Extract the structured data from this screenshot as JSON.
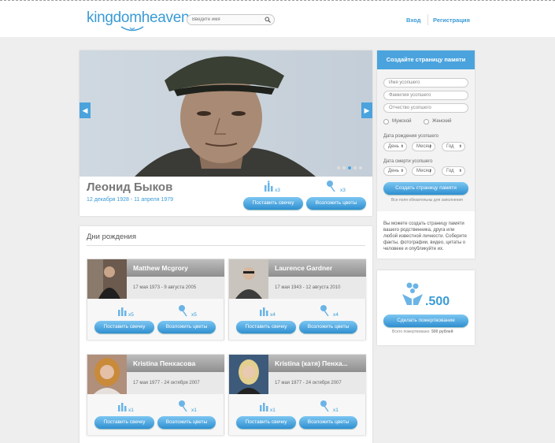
{
  "header": {
    "logo_text": "kingdomheaven",
    "search_placeholder": "Введите имя",
    "login_label": "Вход",
    "register_label": "Регистрация"
  },
  "hero": {
    "name": "Леонид Быков",
    "dates": "12 декабря 1928 - 11 апреля 1979",
    "candle_count": "x3",
    "flower_count": "x3",
    "candle_button": "Поставить свечку",
    "flower_button": "Возложить цветы"
  },
  "memorial_form": {
    "title": "Создайте страницу памяти",
    "first_name_placeholder": "Имя усопшего",
    "last_name_placeholder": "Фамилия усопшего",
    "patronymic_placeholder": "Отчество усопшего",
    "male_label": "Мужской",
    "female_label": "Женский",
    "birth_date_label": "Дата рождения усопшего",
    "death_date_label": "Дата смерти усопшего",
    "day_label": "День",
    "month_label": "Месяц",
    "year_label": "Год",
    "submit_label": "Создать страницу памяти",
    "required_note": "Все поля обязательны для заполнения",
    "info_text": "Вы можете создать страницу памяти вашего родственника, друга или любой известной личности. Соберите факты, фотографии, видео, цитаты о человеке и опубликуйте их."
  },
  "donation": {
    "amount": ".500",
    "button_label": "Сделать пожертвование",
    "total_label": "Всего пожертвовано:",
    "total_value": "500 рублей"
  },
  "birthdays": {
    "title": "Дни рождения",
    "candle_button": "Поставить свечку",
    "flower_button": "Возложить цветы",
    "cards": [
      {
        "name": "Matthew Mcgrory",
        "dates": "17 мая 1973 - 9 августа 2005",
        "candles": "x5",
        "flowers": "x5"
      },
      {
        "name": "Laurence Gardner",
        "dates": "17 мая 1943 - 12 августа 2010",
        "candles": "x4",
        "flowers": "x4"
      },
      {
        "name": "Kristina Пенхасова",
        "dates": "17 мая 1977 - 24 октября 2007",
        "candles": "x1",
        "flowers": "x1"
      },
      {
        "name": "Kristina (катя) Пенха...",
        "dates": "17 мая 1977 - 24 октября 2007",
        "candles": "x1",
        "flowers": "x1"
      }
    ]
  },
  "colors": {
    "accent": "#3a9bd5",
    "button_top": "#7cc6f2",
    "button_bottom": "#2f8fd0",
    "name_bar": "#8e8e8e"
  }
}
